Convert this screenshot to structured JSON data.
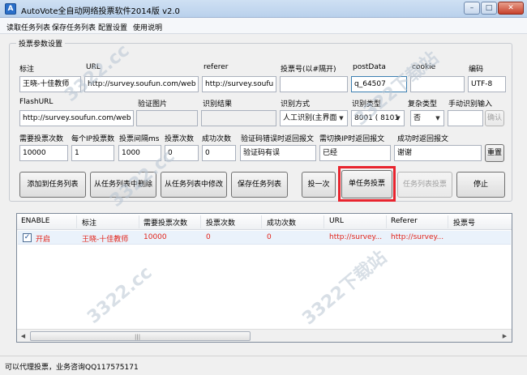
{
  "window": {
    "title": "AutoVote全自动网络投票软件2014版 v2.0",
    "app_icon": "A",
    "buttons": {
      "minimize": "–",
      "maximize": "□",
      "close": "✕"
    }
  },
  "menu": [
    "读取任务列表",
    "保存任务列表",
    "配置设置",
    "使用说明"
  ],
  "group": {
    "title": "投票参数设置"
  },
  "labels": {
    "biaozhu": "标注",
    "url": "URL",
    "referer": "referer",
    "vote_number": "投票号(以#隔开)",
    "postdata": "postData",
    "cookie": "cookie",
    "encoding": "编码",
    "flashurl": "FlashURL",
    "captcha_image": "验证图片",
    "recognize_result": "识别结果",
    "recognize_mode": "识别方式",
    "recognize_type": "识别类型",
    "complex_type": "复杂类型",
    "manual_input": "手动识别输入",
    "vote_count_needed": "需要投票次数",
    "per_ip_count": "每个IP投票数",
    "vote_interval": "投票间隔ms",
    "voted_count": "投票次数",
    "success_count": "成功次数",
    "captcha_error_msg": "验证码错误时返回报文",
    "switch_ip_msg": "需切换IP时返回报文",
    "success_msg": "成功时返回报文"
  },
  "fields": {
    "biaozhu": "王晓-十佳教师",
    "url": "http://survey.soufun.com/web",
    "referer": "http://survey.soufu",
    "vote_number": "",
    "postdata": "q_64507",
    "cookie": "",
    "encoding": "UTF-8",
    "flashurl": "http://survey.soufun.com/web",
    "captcha_image": "",
    "recognize_result": "",
    "recognize_mode": "人工识别(主界面",
    "recognize_type": "8001 ( 8101",
    "complex_type": "否",
    "manual_input": "",
    "vote_count_needed": "10000",
    "per_ip_count": "1",
    "vote_interval": "1000",
    "voted_count": "0",
    "success_count": "0",
    "captcha_error_msg": "验证码有误",
    "switch_ip_msg": "已经",
    "success_msg": "谢谢"
  },
  "buttons": {
    "identify": "确认",
    "reset": "重置",
    "add_to_list": "添加到任务列表",
    "delete_from_list": "从任务列表中删除",
    "modify_in_list": "从任务列表中修改",
    "save_list": "保存任务列表",
    "vote_once": "投一次",
    "single_task_vote": "单任务投票",
    "list_vote": "任务列表投票",
    "stop": "停止"
  },
  "table": {
    "columns": [
      "ENABLE",
      "标注",
      "需要投票次数",
      "投票次数",
      "成功次数",
      "URL",
      "Referer",
      "投票号"
    ],
    "rows": [
      {
        "checked": "✓",
        "enable": "开启",
        "biaozhu": "王晓-十佳教师",
        "needed": "10000",
        "voted": "0",
        "success": "0",
        "url": "http://survey...",
        "referer": "http://survey..."
      }
    ]
  },
  "scrollbar": {
    "left": "◀",
    "right": "▶",
    "grip": "|||"
  },
  "status": "可以代理投票，业务咨询QQ117575171",
  "watermarks": [
    "3322.cc",
    "3322下载站",
    "3322.cc",
    "3322下载站",
    "3322.cc"
  ]
}
